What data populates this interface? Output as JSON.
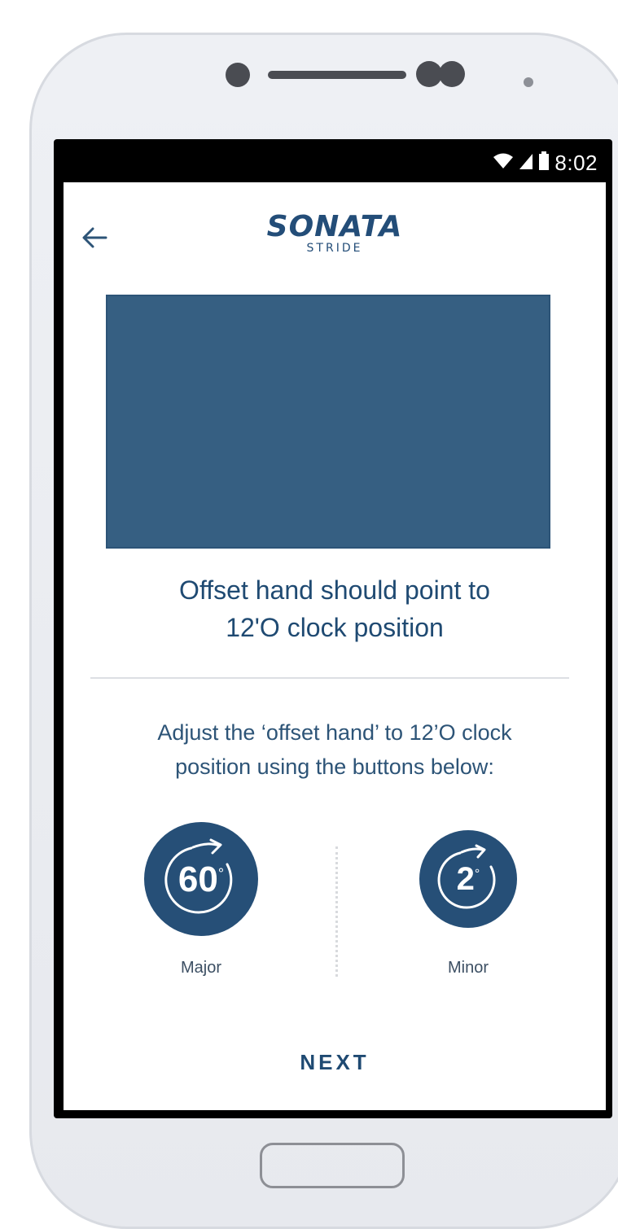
{
  "status_bar": {
    "time": "8:02",
    "icons": [
      "wifi-icon",
      "signal-icon",
      "battery-icon"
    ]
  },
  "header": {
    "back_icon": "arrow-left-icon",
    "logo_text": "SONATA",
    "logo_subtext": "STRIDE"
  },
  "main": {
    "heading_line1": "Offset hand should point to",
    "heading_line2": "12'O clock position",
    "instruction_line1": "Adjust the ‘offset hand’ to 12’O clock",
    "instruction_line2": "position using the buttons below:",
    "major": {
      "value": "60",
      "unit": "°",
      "label": "Major",
      "icon": "rotate-clockwise-icon"
    },
    "minor": {
      "value": "2",
      "unit": "°",
      "label": "Minor",
      "icon": "rotate-clockwise-icon"
    }
  },
  "footer": {
    "next_label": "NEXT"
  },
  "colors": {
    "primary": "#264f77",
    "image_placeholder": "#365f82",
    "text_primary": "#1f4a72"
  }
}
